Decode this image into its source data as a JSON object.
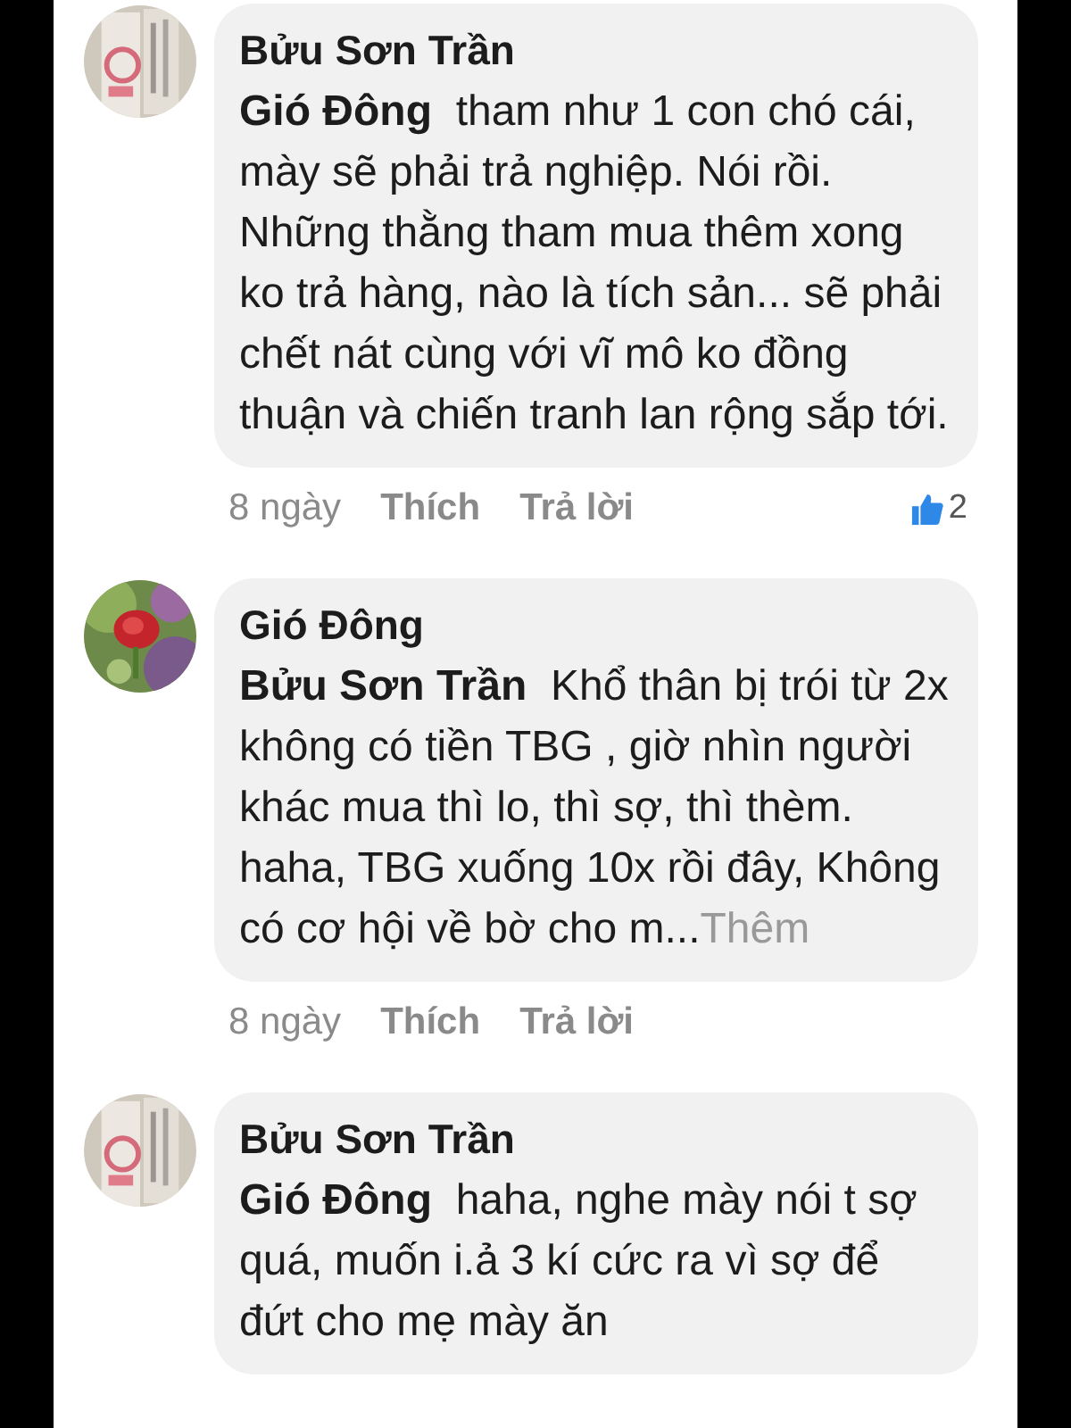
{
  "comments": [
    {
      "author": "Bửu Sơn Trần",
      "text": "**Gió Đông**  tham như 1 con chó cái, mày sẽ phải trả nghiệp. Nói rồi. Những thằng tham mua thêm xong ko trả hàng, nào là tích sản... sẽ phải chết nát cùng với vĩ mô ko đồng thuận và chiến tranh lan rộng sắp tới.",
      "time": "8 ngày",
      "like": "Thích",
      "reply": "Trả lời",
      "reactions": "2"
    },
    {
      "author": "Gió Đông",
      "text": "**Bửu Sơn Trần**  Khổ thân bị trói từ 2x không có tiền TBG , giờ nhìn người khác mua thì lo, thì sợ, thì thèm. haha, TBG xuống 10x rồi đây, Không có cơ hội về bờ cho m...",
      "more": "Thêm",
      "time": "8 ngày",
      "like": "Thích",
      "reply": "Trả lời"
    },
    {
      "author": "Bửu Sơn Trần",
      "text": "**Gió Đông**  haha, nghe mày nói t sợ quá, muốn i.ả 3 kí cức ra vì sợ để đứt cho mẹ mày ăn"
    }
  ]
}
